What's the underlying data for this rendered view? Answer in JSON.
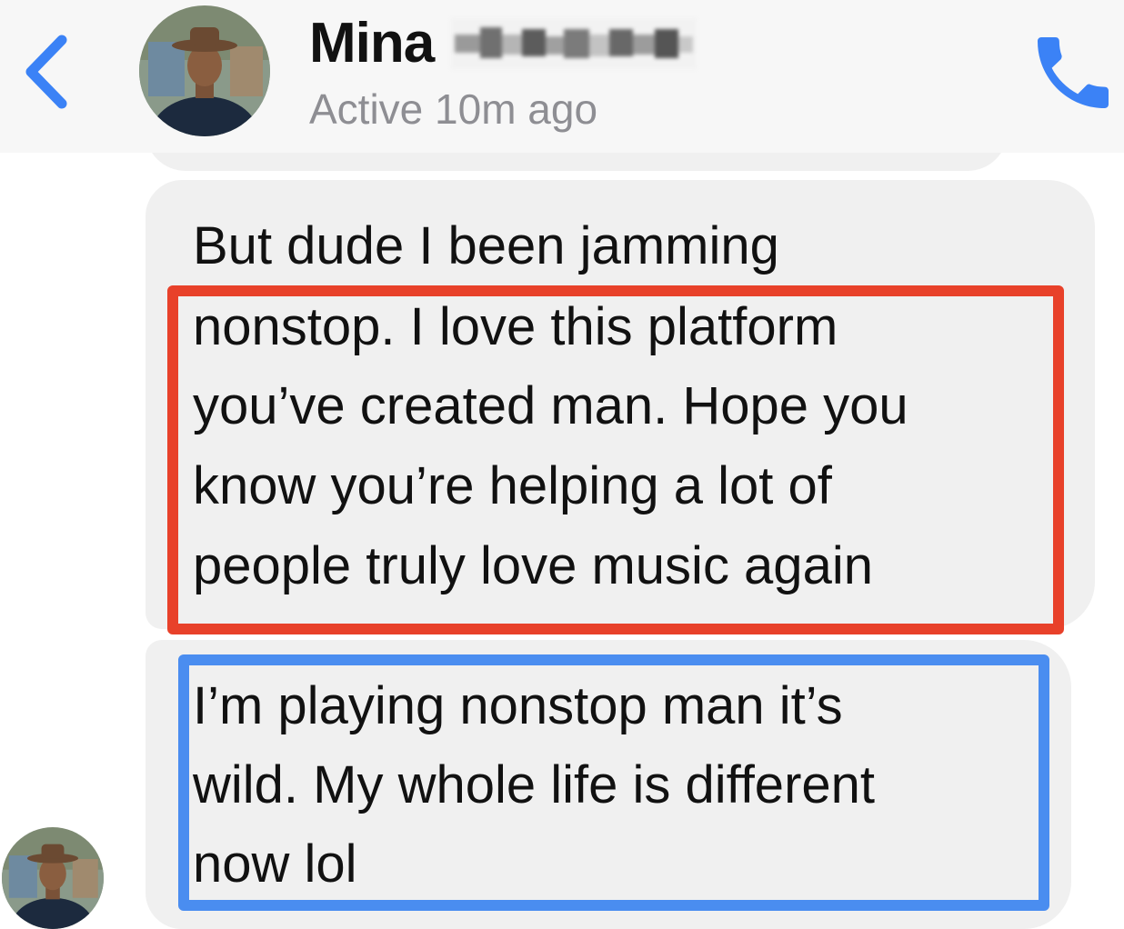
{
  "header": {
    "contact_name": "Mina",
    "status": "Active 10m ago",
    "back_icon": "chevron-left-icon",
    "call_icon": "phone-icon"
  },
  "messages": [
    {
      "lines": [
        "But dude I been jamming",
        "nonstop. I love this platform",
        "you’ve created man. Hope you",
        "know you’re helping a lot of",
        "people truly love music again"
      ]
    },
    {
      "lines": [
        "I’m playing nonstop man it’s",
        "wild. My whole life is different",
        "now lol"
      ]
    }
  ],
  "highlights": [
    {
      "color": "#e8412a"
    },
    {
      "color": "#4a8df0"
    }
  ],
  "colors": {
    "accent": "#3b82f6",
    "bubble": "#f0f0f0",
    "header_bg": "#f7f7f7",
    "status_text": "#8e8e93"
  }
}
